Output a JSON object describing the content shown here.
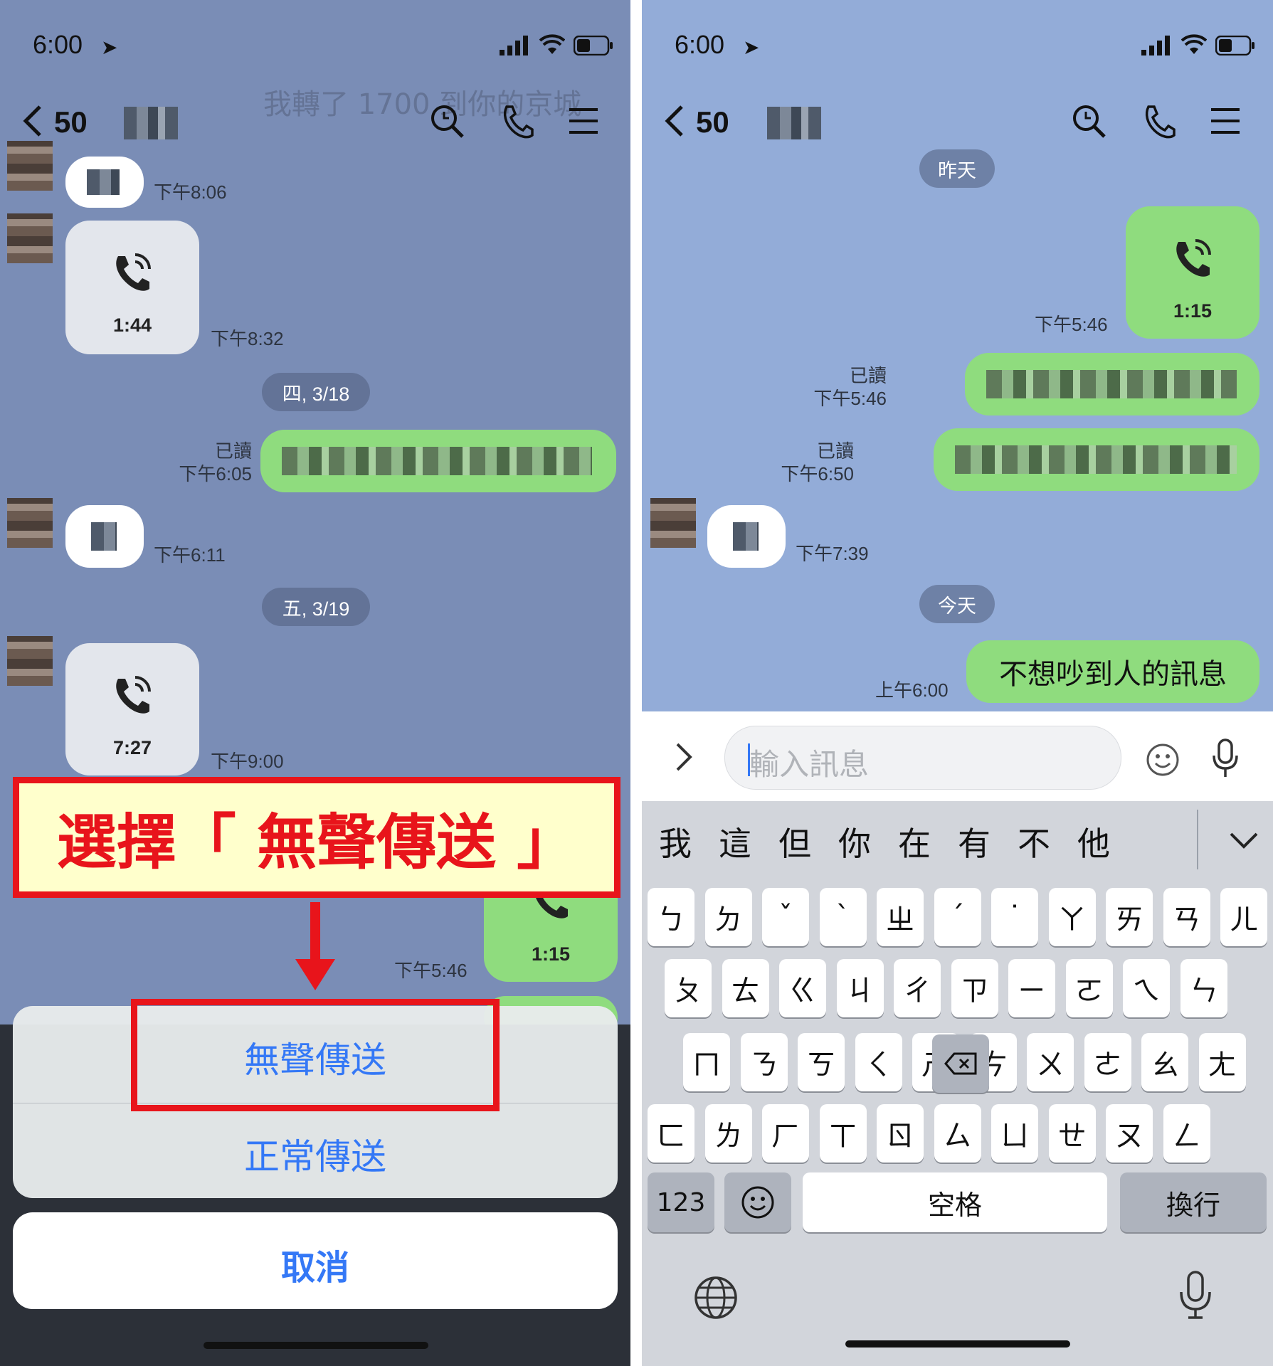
{
  "left": {
    "status_time": "6:00",
    "back_count": "50",
    "ghost_text": "我轉了 1700 到你的京城",
    "messages": {
      "m1_time": "下午8:06",
      "call1_duration": "1:44",
      "call1_time": "下午8:32",
      "date1": "四, 3/18",
      "m3_read": "已讀",
      "m3_time": "下午6:05",
      "m4_time": "下午6:11",
      "date2": "五, 3/19",
      "call2_duration": "7:27",
      "call2_time": "下午9:00",
      "call3_duration": "1:15",
      "call3_time": "下午5:46"
    },
    "annotation": "選擇「 無聲傳送 」",
    "sheet": {
      "silent_send": "無聲傳送",
      "normal_send": "正常傳送",
      "cancel": "取消"
    }
  },
  "right": {
    "status_time": "6:00",
    "back_count": "50",
    "messages": {
      "date_yesterday": "昨天",
      "call_duration": "1:15",
      "call_time": "下午5:46",
      "m2_read": "已讀",
      "m2_time": "下午5:46",
      "m3_read": "已讀",
      "m3_time": "下午6:50",
      "m4_time": "下午7:39",
      "date_today": "今天",
      "m5_text": "不想吵到人的訊息",
      "m5_time": "上午6:00"
    },
    "input": {
      "placeholder": "輸入訊息"
    },
    "keyboard": {
      "candidates": [
        "我",
        "這",
        "但",
        "你",
        "在",
        "有",
        "不",
        "他"
      ],
      "row1": [
        "ㄅ",
        "ㄉ",
        "ˇ",
        "ˋ",
        "ㄓ",
        "ˊ",
        "˙",
        "ㄚ",
        "ㄞ",
        "ㄢ",
        "ㄦ"
      ],
      "row2": [
        "ㄆ",
        "ㄊ",
        "ㄍ",
        "ㄐ",
        "ㄔ",
        "ㄗ",
        "ㄧ",
        "ㄛ",
        "ㄟ",
        "ㄣ"
      ],
      "row3": [
        "ㄇ",
        "ㄋ",
        "ㄎ",
        "ㄑ",
        "ㄕ",
        "ㄘ",
        "ㄨ",
        "ㄜ",
        "ㄠ",
        "ㄤ"
      ],
      "row4": [
        "ㄈ",
        "ㄌ",
        "ㄏ",
        "ㄒ",
        "ㄖ",
        "ㄙ",
        "ㄩ",
        "ㄝ",
        "ㄡ",
        "ㄥ"
      ],
      "numbers_key": "123",
      "space_key": "空格",
      "return_key": "換行"
    }
  }
}
